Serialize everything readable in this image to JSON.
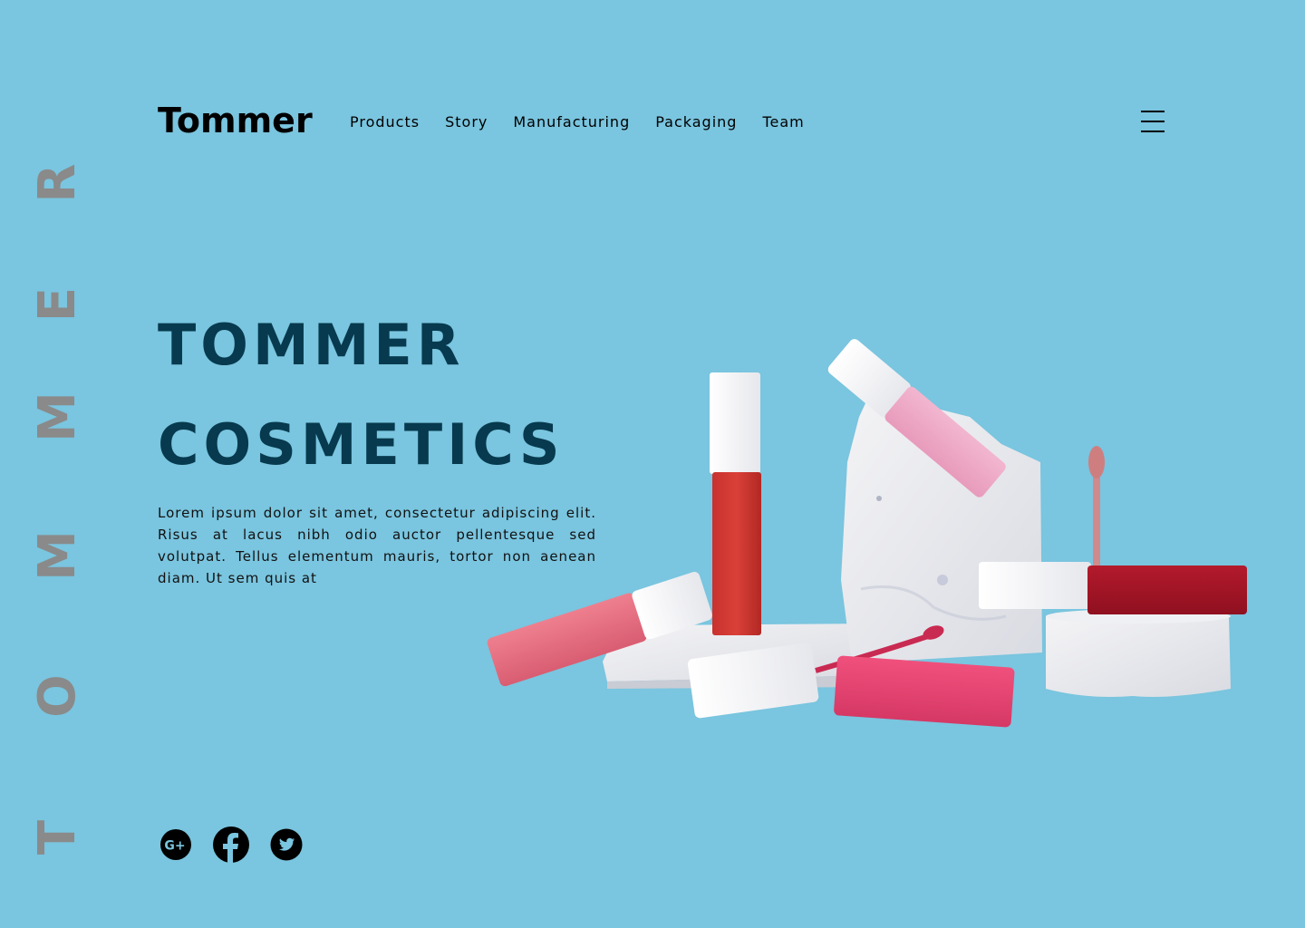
{
  "side_brand": {
    "letters": [
      "T",
      "O",
      "M",
      "M",
      "E",
      "R"
    ]
  },
  "header": {
    "logo": "Tommer",
    "nav": [
      "Products",
      "Story",
      "Manufacturing",
      "Packaging",
      "Team"
    ],
    "menu_icon": "hamburger-menu-icon"
  },
  "hero": {
    "title_line1": "TOMMER",
    "title_line2": "COSMETICS",
    "description": "Lorem ipsum dolor sit amet, consectetur adipiscing elit. Risus at lacus nibh odio auctor pellentesque sed volutpat. Tellus elementum mauris, tortor non aenean diam. Ut sem quis at"
  },
  "social": [
    {
      "icon": "google-plus-icon"
    },
    {
      "icon": "facebook-icon"
    },
    {
      "icon": "twitter-icon"
    }
  ],
  "colors": {
    "background": "#7ac5df",
    "title": "#073a4e",
    "side_text": "#8a8a8a"
  },
  "product_image": "lip gloss tubes on white stone blocks"
}
